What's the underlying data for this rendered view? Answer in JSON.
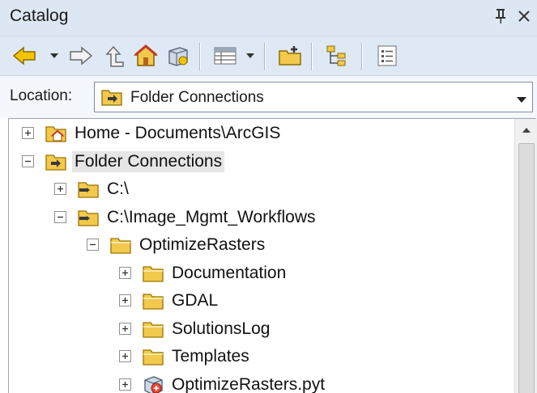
{
  "window": {
    "title": "Catalog"
  },
  "location": {
    "label": "Location:",
    "value": "Folder Connections"
  },
  "tree": [
    {
      "label": "Home - Documents\\ArcGIS",
      "icon": "home-folder-icon",
      "expander": "plus",
      "selected": false
    },
    {
      "label": "Folder Connections",
      "icon": "folder-connections-icon",
      "expander": "minus",
      "selected": true
    },
    {
      "label": "C:\\",
      "icon": "folder-connection-icon",
      "expander": "plus",
      "selected": false
    },
    {
      "label": "C:\\Image_Mgmt_Workflows",
      "icon": "folder-connection-icon",
      "expander": "minus",
      "selected": false
    },
    {
      "label": "OptimizeRasters",
      "icon": "folder-icon",
      "expander": "minus",
      "selected": false
    },
    {
      "label": "Documentation",
      "icon": "folder-icon",
      "expander": "plus",
      "selected": false
    },
    {
      "label": "GDAL",
      "icon": "folder-icon",
      "expander": "plus",
      "selected": false
    },
    {
      "label": "SolutionsLog",
      "icon": "folder-icon",
      "expander": "plus",
      "selected": false
    },
    {
      "label": "Templates",
      "icon": "folder-icon",
      "expander": "plus",
      "selected": false
    },
    {
      "label": "OptimizeRasters.pyt",
      "icon": "python-toolbox-icon",
      "expander": "plus",
      "selected": false
    }
  ],
  "colors": {
    "titlebar": "#dde7f3",
    "toolbar": "#dfe9f5",
    "folder": "#f2c94c",
    "arrow_yellow": "#f5c400",
    "selection": "#e6e6e6"
  }
}
